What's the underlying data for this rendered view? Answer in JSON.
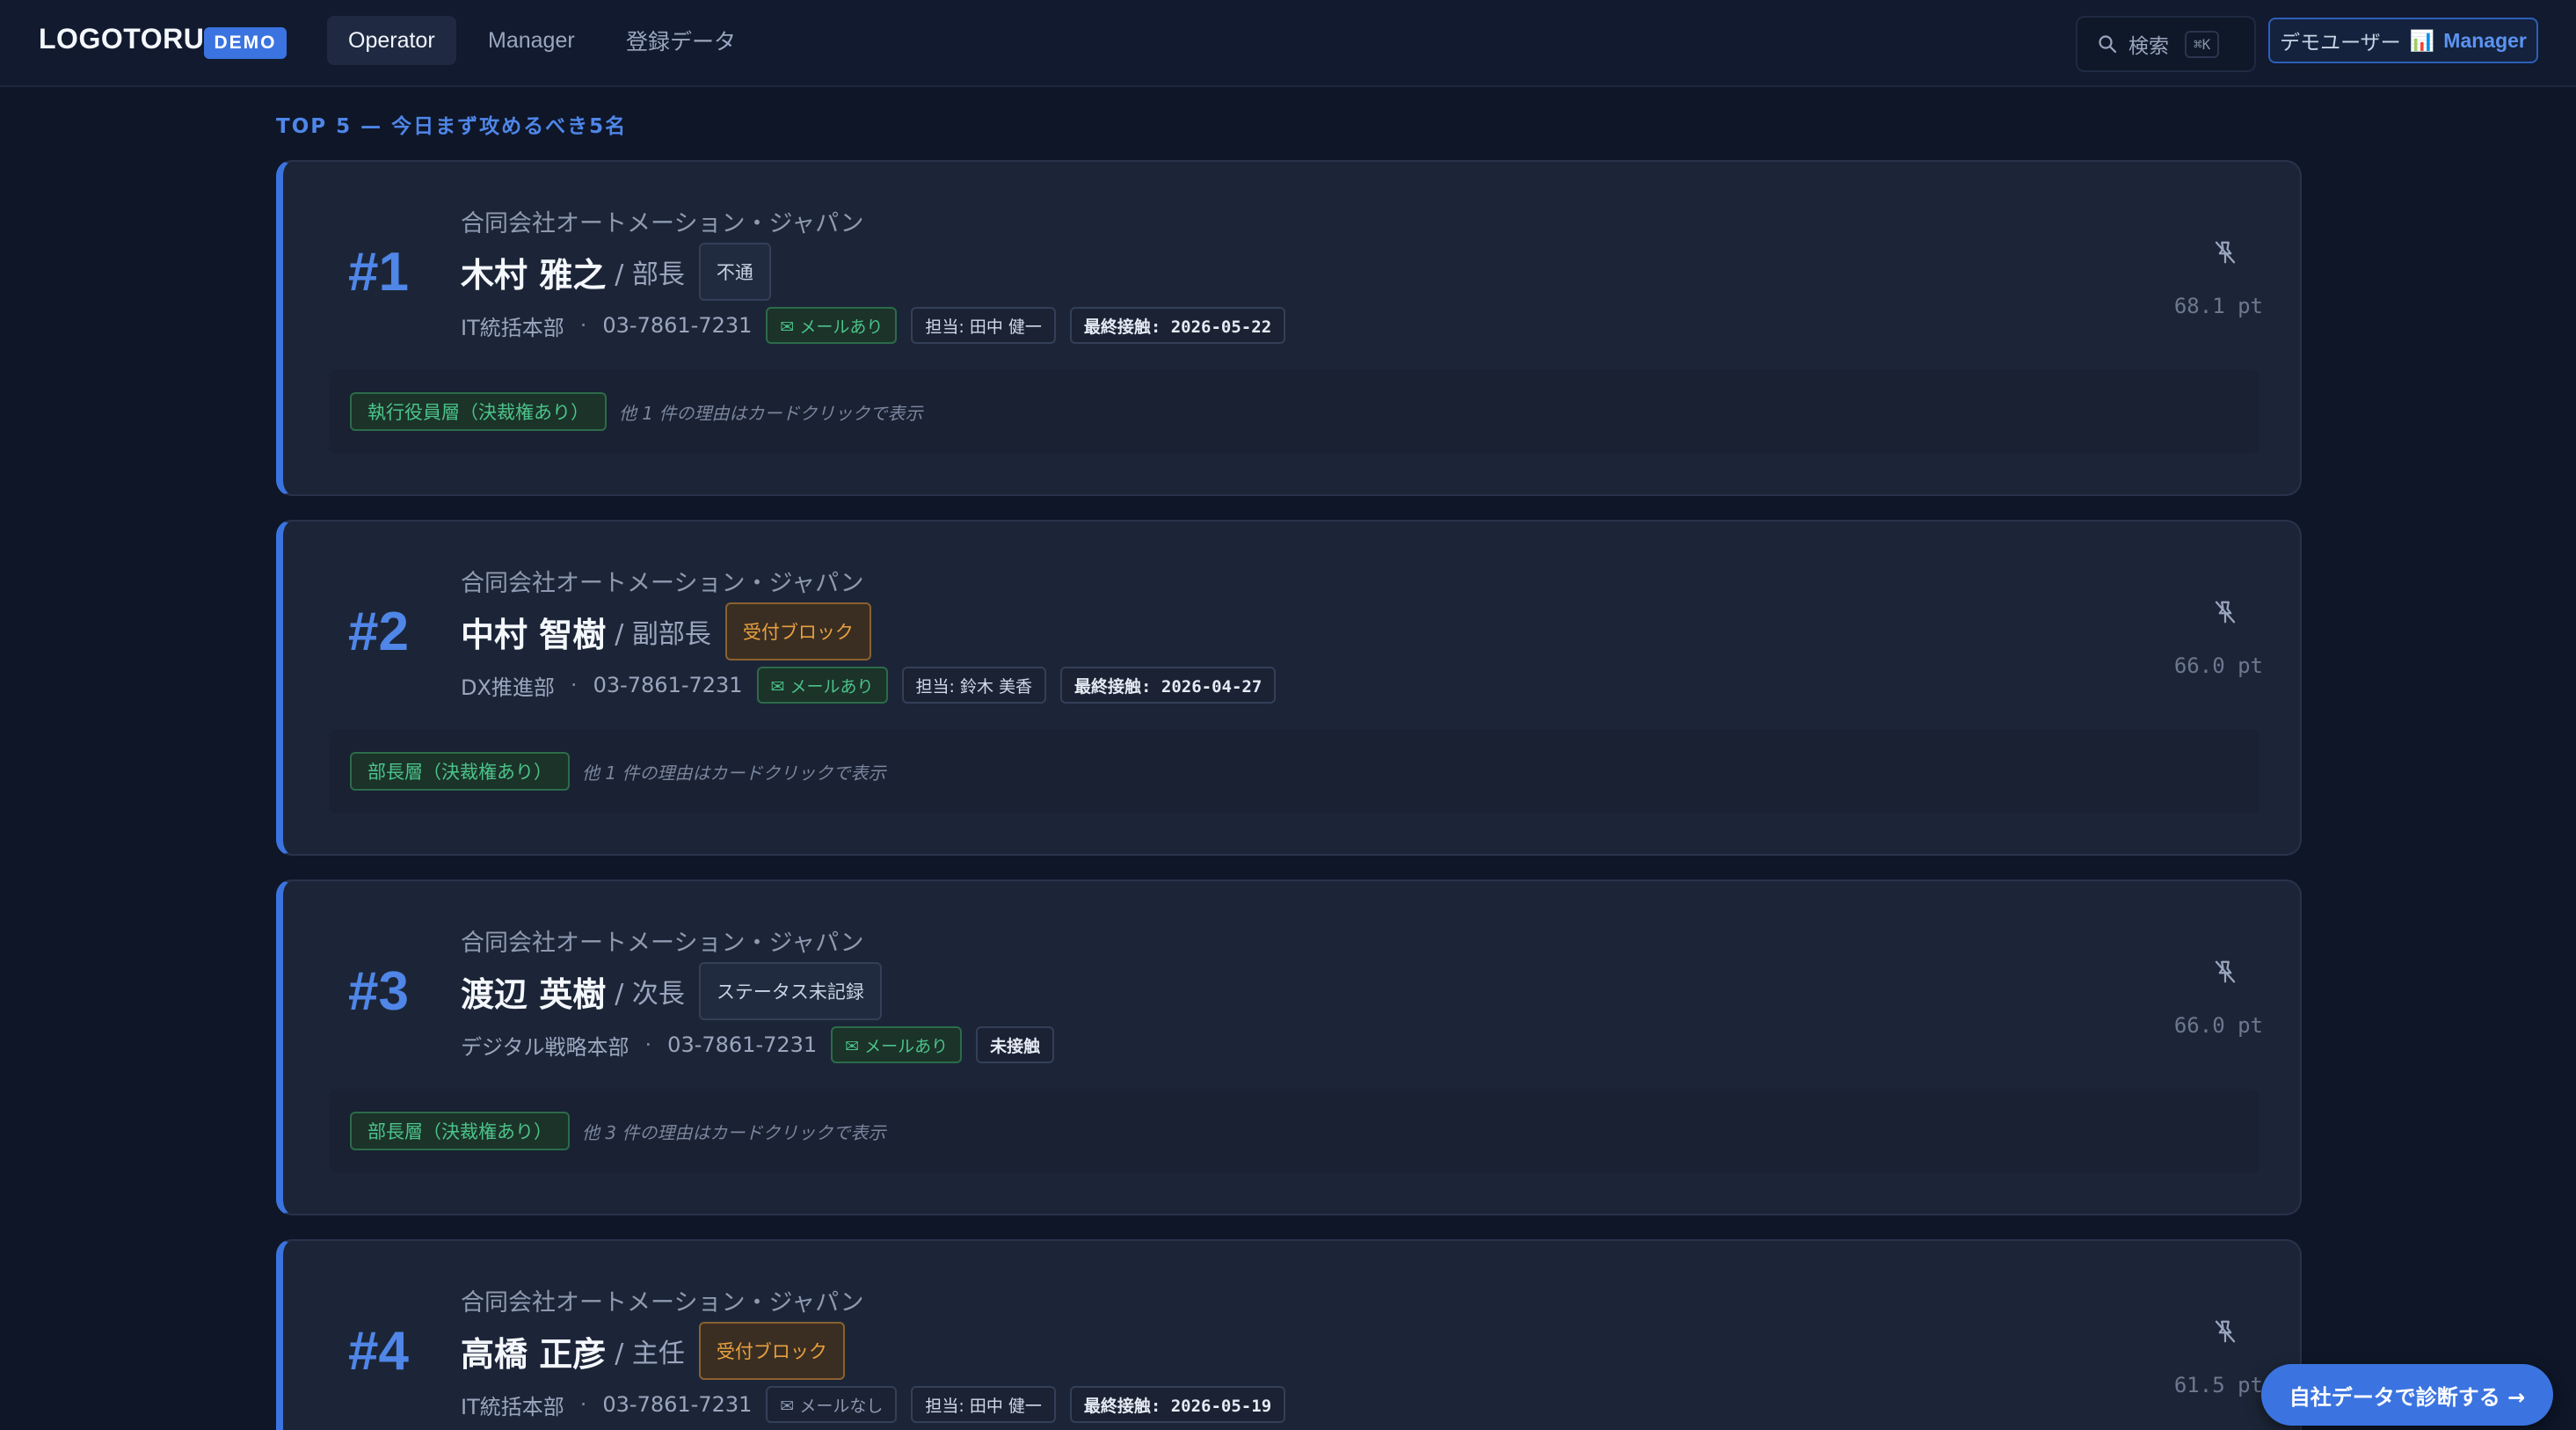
{
  "header": {
    "logo": "LOGOTORU",
    "demo_badge": "DEMO",
    "tabs": [
      {
        "label": "Operator",
        "active": true
      },
      {
        "label": "Manager",
        "active": false
      },
      {
        "label": "登録データ",
        "active": false
      }
    ],
    "search_label": "検索",
    "search_shortcut": "⌘K",
    "user_name": "デモユーザー",
    "user_role_icon": "📊",
    "user_role": "Manager"
  },
  "section_title": "TOP 5 — 今日まず攻めるべき5名",
  "cards": [
    {
      "rank": "#1",
      "company": "合同会社オートメーション・ジャパン",
      "name": "木村 雅之",
      "title": "/ 部長",
      "status": "不通",
      "status_kind": "neutral",
      "department": "IT統括本部",
      "phone": "03-7861-7231",
      "mail_label": "✉ メールあり",
      "mail_kind": "mail",
      "owner": "担当: 田中 健一",
      "last_contact": "最終接触: 2026-05-22",
      "score": "68.1 pt",
      "reason_tag": "執行役員層（決裁権あり）",
      "reason_note": "他 1 件の理由はカードクリックで表示"
    },
    {
      "rank": "#2",
      "company": "合同会社オートメーション・ジャパン",
      "name": "中村 智樹",
      "title": "/ 副部長",
      "status": "受付ブロック",
      "status_kind": "block",
      "department": "DX推進部",
      "phone": "03-7861-7231",
      "mail_label": "✉ メールあり",
      "mail_kind": "mail",
      "owner": "担当: 鈴木 美香",
      "last_contact": "最終接触: 2026-04-27",
      "score": "66.0 pt",
      "reason_tag": "部長層（決裁権あり）",
      "reason_note": "他 1 件の理由はカードクリックで表示"
    },
    {
      "rank": "#3",
      "company": "合同会社オートメーション・ジャパン",
      "name": "渡辺 英樹",
      "title": "/ 次長",
      "status": "ステータス未記録",
      "status_kind": "neutral",
      "department": "デジタル戦略本部",
      "phone": "03-7861-7231",
      "mail_label": "✉ メールあり",
      "mail_kind": "mail",
      "owner": "",
      "last_contact": "未接触",
      "score": "66.0 pt",
      "reason_tag": "部長層（決裁権あり）",
      "reason_note": "他 3 件の理由はカードクリックで表示"
    },
    {
      "rank": "#4",
      "company": "合同会社オートメーション・ジャパン",
      "name": "高橋 正彦",
      "title": "/ 主任",
      "status": "受付ブロック",
      "status_kind": "block",
      "department": "IT統括本部",
      "phone": "03-7861-7231",
      "mail_label": "✉ メールなし",
      "mail_kind": "nomail",
      "owner": "担当: 田中 健一",
      "last_contact": "最終接触: 2026-05-19",
      "score": "61.5 pt",
      "reason_tag": "",
      "reason_note": ""
    }
  ],
  "cta_label": "自社データで診断する →",
  "colors": {
    "accent": "#3b74e0",
    "background": "#0e1628",
    "card": "#1c2537",
    "mail_green": "#4cc38a",
    "block_orange": "#e8a040"
  }
}
